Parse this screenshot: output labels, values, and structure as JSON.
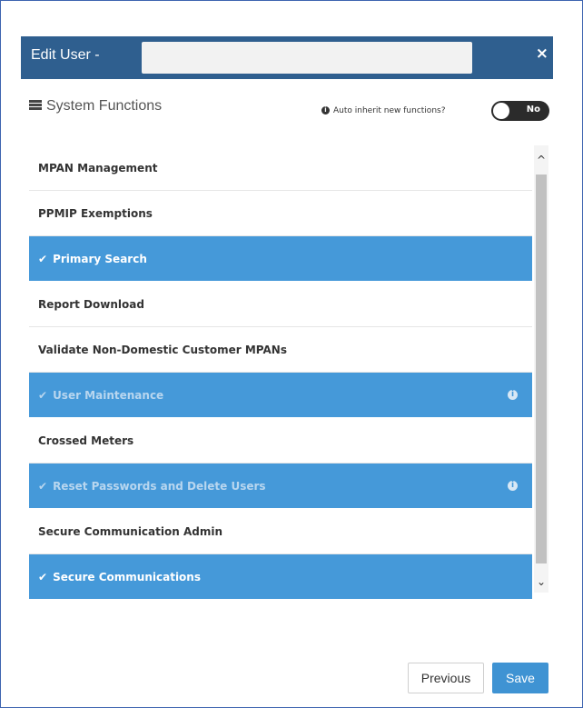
{
  "modal": {
    "title": "Edit User - ",
    "close_glyph": "×"
  },
  "section": {
    "title": "System Functions",
    "icon": "list-icon"
  },
  "auto_inherit": {
    "label": "Auto inherit new functions?",
    "info_glyph": "i",
    "toggle_text": "No",
    "toggle_on": false
  },
  "functions": [
    {
      "label": "MPAN Management",
      "selected": false,
      "faded": false,
      "info": false
    },
    {
      "label": "PPMIP Exemptions",
      "selected": false,
      "faded": false,
      "info": false
    },
    {
      "label": "Primary Search",
      "selected": true,
      "faded": false,
      "info": false
    },
    {
      "label": "Report Download",
      "selected": false,
      "faded": false,
      "info": false
    },
    {
      "label": "Validate Non-Domestic Customer MPANs",
      "selected": false,
      "faded": false,
      "info": false
    },
    {
      "label": "User Maintenance",
      "selected": true,
      "faded": true,
      "info": true
    },
    {
      "label": "Crossed Meters",
      "selected": false,
      "faded": false,
      "info": false
    },
    {
      "label": "Reset Passwords and Delete Users",
      "selected": true,
      "faded": true,
      "info": true
    },
    {
      "label": "Secure Communication Admin",
      "selected": false,
      "faded": false,
      "info": false
    },
    {
      "label": "Secure Communications",
      "selected": true,
      "faded": false,
      "info": false
    }
  ],
  "scroll": {
    "up_glyph": "^",
    "down_glyph": "⌄"
  },
  "buttons": {
    "previous": "Previous",
    "save": "Save"
  },
  "colors": {
    "header": "#2f5f8f",
    "selected_row": "#4599d9",
    "save_button": "#3f93d3"
  }
}
